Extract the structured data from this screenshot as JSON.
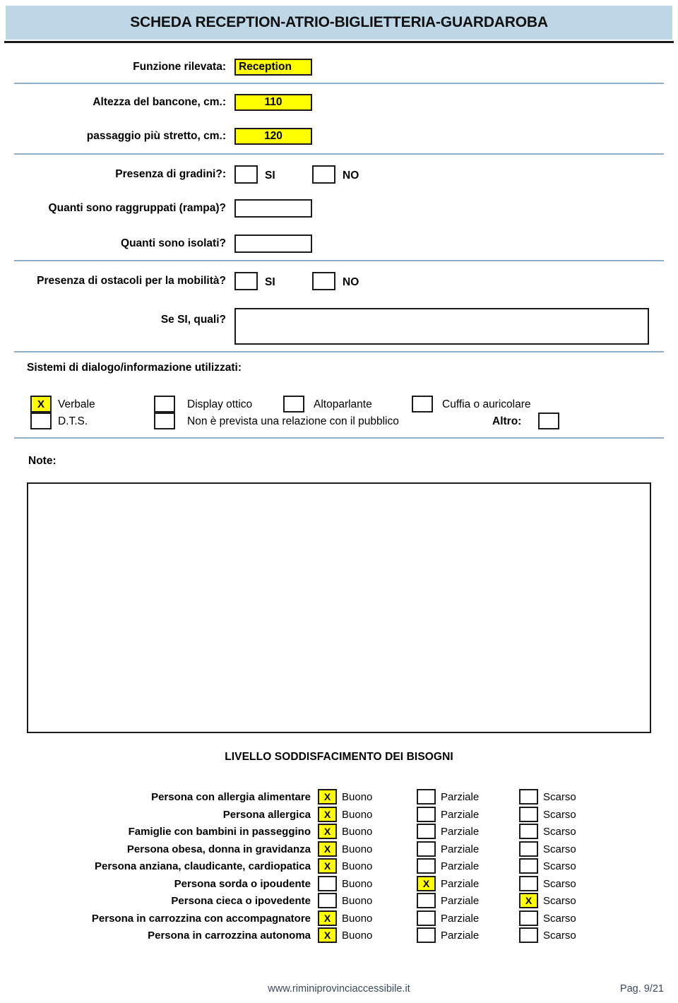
{
  "header": {
    "title": "SCHEDA RECEPTION-ATRIO-BIGLIETTERIA-GUARDAROBA"
  },
  "form": {
    "funzione_rilevata": {
      "label": "Funzione rilevata:",
      "value": "Reception"
    },
    "altezza_bancone": {
      "label": "Altezza del bancone, cm.:",
      "value": "110"
    },
    "passaggio_stretto": {
      "label": "passaggio più stretto, cm.:",
      "value": "120"
    },
    "presenza_gradini": {
      "label": "Presenza di gradini?:",
      "si_label": "SI",
      "no_label": "NO",
      "si_checked": "",
      "no_checked": ""
    },
    "quanti_raggruppati": {
      "label": "Quanti sono raggruppati (rampa)?",
      "value": ""
    },
    "quanti_isolati": {
      "label": "Quanti sono isolati?",
      "value": ""
    },
    "presenza_ostacoli": {
      "label": "Presenza di ostacoli per la mobilità?",
      "si_label": "SI",
      "no_label": "NO",
      "si_checked": "",
      "no_checked": ""
    },
    "se_si_quali": {
      "label": "Se SI, quali?",
      "value": ""
    }
  },
  "sistemi": {
    "title": "Sistemi di dialogo/informazione utilizzati:",
    "altro_label": "Altro:",
    "altro_value": "",
    "options": [
      {
        "label": "Verbale",
        "mark": "X"
      },
      {
        "label": "Display ottico",
        "mark": ""
      },
      {
        "label": "Altoparlante",
        "mark": ""
      },
      {
        "label": "Cuffia o auricolare",
        "mark": ""
      },
      {
        "label": "D.T.S.",
        "mark": ""
      },
      {
        "label": "Non è prevista una relazione con il pubblico",
        "mark": ""
      }
    ]
  },
  "note": {
    "label": "Note:",
    "value": ""
  },
  "needs": {
    "title": "LIVELLO SODDISFACIMENTO DEI BISOGNI",
    "columns": [
      "Buono",
      "Parziale",
      "Scarso"
    ],
    "rows": [
      {
        "label": "Persona con allergia alimentare",
        "buono": "X",
        "parziale": "",
        "scarso": ""
      },
      {
        "label": "Persona allergica",
        "buono": "X",
        "parziale": "",
        "scarso": ""
      },
      {
        "label": "Famiglie con bambini in passeggino",
        "buono": "X",
        "parziale": "",
        "scarso": ""
      },
      {
        "label": "Persona obesa, donna in gravidanza",
        "buono": "X",
        "parziale": "",
        "scarso": ""
      },
      {
        "label": "Persona anziana, claudicante, cardiopatica",
        "buono": "X",
        "parziale": "",
        "scarso": ""
      },
      {
        "label": "Persona sorda o ipoudente",
        "buono": "",
        "parziale": "X",
        "scarso": ""
      },
      {
        "label": "Persona cieca o ipovedente",
        "buono": "",
        "parziale": "",
        "scarso": "X"
      },
      {
        "label": "Persona in carrozzina con accompagnatore",
        "buono": "X",
        "parziale": "",
        "scarso": ""
      },
      {
        "label": "Persona in carrozzina autonoma",
        "buono": "X",
        "parziale": "",
        "scarso": ""
      }
    ]
  },
  "footer": {
    "url": "www.riminiprovinciaccessibile.it",
    "page": "Pag. 9/21"
  },
  "colors": {
    "header_band": "#bdd7e7",
    "highlight": "#ffff00",
    "divider": "#8faecd",
    "footer_text": "#3a4a5e"
  }
}
